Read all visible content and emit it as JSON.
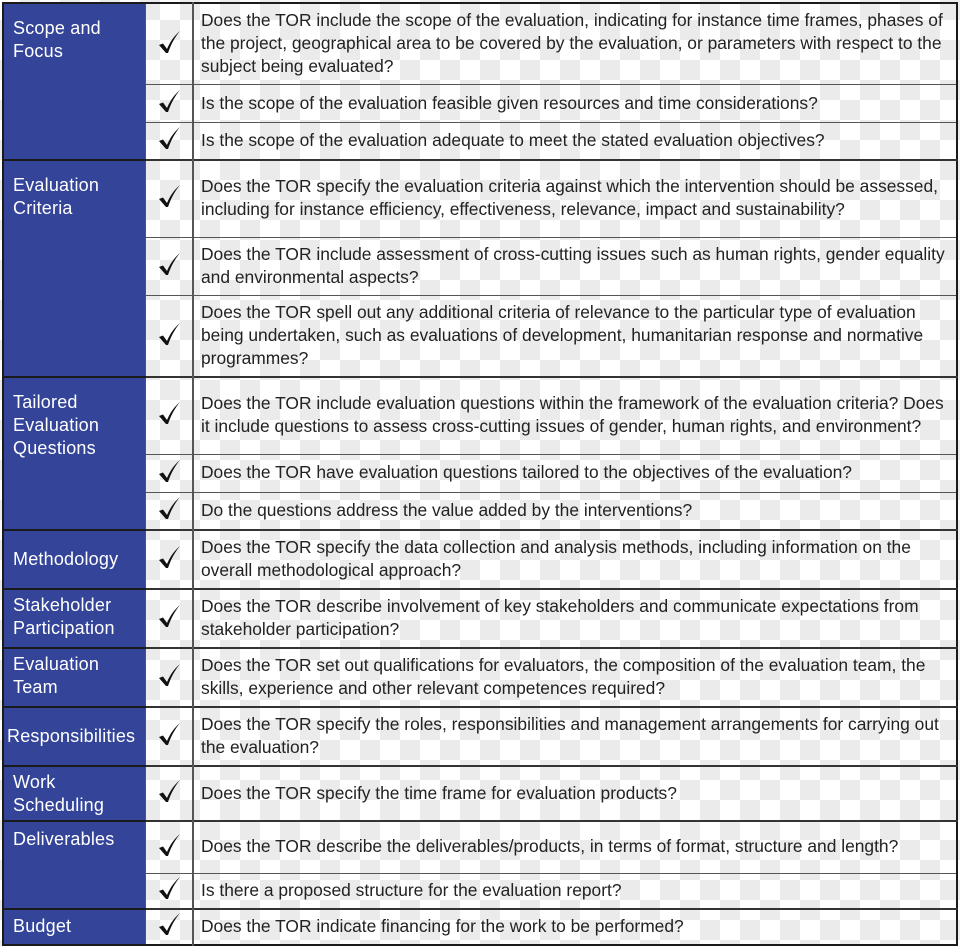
{
  "checklist": {
    "categories": [
      {
        "label": "Scope and\nFocus",
        "questions": [
          {
            "text": "Does the TOR include the scope of the evaluation, indicating for instance time frames, phases of the project, geographical area to be covered by the evaluation, or parameters with respect to the subject being evaluated?",
            "checked": true
          },
          {
            "text": "Is the scope of the evaluation feasible given resources and time considerations?",
            "checked": true
          },
          {
            "text": "Is the scope of the evaluation adequate to meet the stated evaluation objectives?",
            "checked": true
          }
        ]
      },
      {
        "label": "Evaluation\nCriteria",
        "questions": [
          {
            "text": "Does the TOR specify the evaluation criteria against which the intervention should be assessed, including for instance efficiency, effectiveness, relevance, impact and sustainability?",
            "checked": true
          },
          {
            "text": "Does the TOR include assessment of cross-cutting issues such as human rights, gender equality and environmental aspects?",
            "checked": true
          },
          {
            "text": "Does the TOR spell out any additional criteria of relevance to the particular type of evaluation being undertaken, such as evaluations of development, humanitarian response and normative programmes?",
            "checked": true
          }
        ]
      },
      {
        "label": "Tailored\nEvaluation\nQuestions",
        "questions": [
          {
            "text": "Does the TOR include evaluation questions within the framework of the evaluation criteria? Does it include questions to assess cross-cutting issues of gender, human rights, and environment?",
            "checked": true
          },
          {
            "text": "Does the TOR have evaluation questions tailored to the objectives of the evaluation?",
            "checked": true
          },
          {
            "text": "Do the questions address the value added by the interventions?",
            "checked": true
          }
        ]
      },
      {
        "label": "Methodology",
        "questions": [
          {
            "text": "Does the TOR specify the data collection and analysis methods, including information on the overall methodological approach?",
            "checked": true
          }
        ]
      },
      {
        "label": "Stakeholder\nParticipation",
        "questions": [
          {
            "text": "Does the TOR describe involvement of key stakeholders and communicate expectations from stakeholder participation?",
            "checked": true
          }
        ]
      },
      {
        "label": "Evaluation\nTeam",
        "questions": [
          {
            "text": "Does the TOR set out qualifications for evaluators, the composition of the evaluation team, the skills, experience and other relevant competences required?",
            "checked": true
          }
        ]
      },
      {
        "label": "Responsibilities",
        "questions": [
          {
            "text": "Does the TOR specify the roles, responsibilities and management arrangements for carrying out the evaluation?",
            "checked": true
          }
        ]
      },
      {
        "label": "Work\nScheduling",
        "questions": [
          {
            "text": "Does the TOR specify the time frame for evaluation products?",
            "checked": true
          }
        ]
      },
      {
        "label": "Deliverables",
        "questions": [
          {
            "text": "Does the TOR describe the deliverables/products, in terms of format, structure and length?",
            "checked": true
          },
          {
            "text": "Is there a proposed structure for the evaluation report?",
            "checked": true
          }
        ]
      },
      {
        "label": "Budget",
        "questions": [
          {
            "text": "Does the TOR indicate financing for the work to be performed?",
            "checked": true
          }
        ]
      }
    ],
    "colors": {
      "category_bg": "#334499",
      "category_text": "#ffffff",
      "question_text": "#222222"
    }
  }
}
